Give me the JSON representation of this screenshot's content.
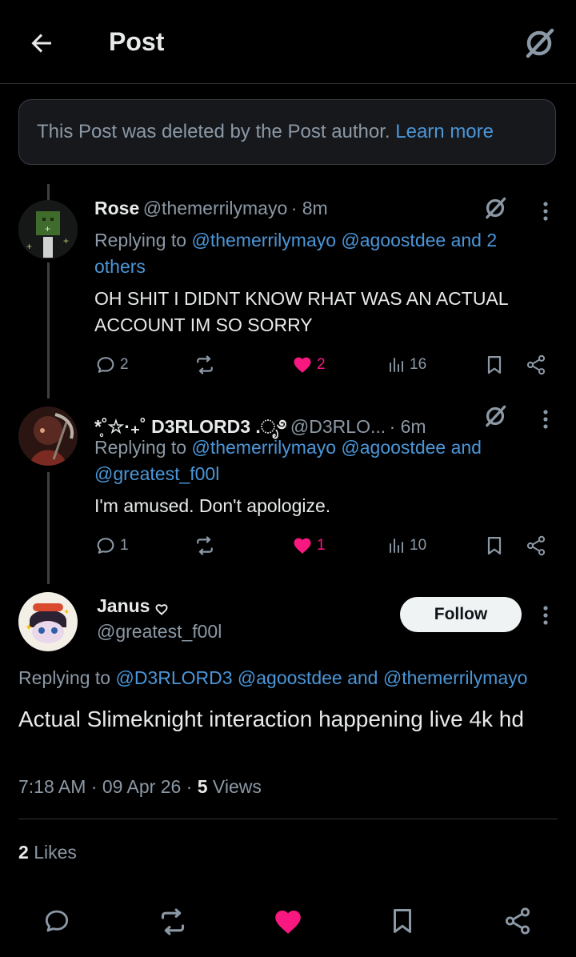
{
  "header": {
    "title": "Post",
    "back_icon": "arrow-left-icon",
    "grok_icon": "grok-icon"
  },
  "deleted_notice": {
    "text": "This Post was deleted by the Post author.",
    "link": "Learn more"
  },
  "replies": [
    {
      "name": "Rose",
      "handle": "@themerrilymayo",
      "time": "· 8m",
      "replying_prefix": "Replying to",
      "replying_line1": "@themerrilymayo @agoostdee and 2",
      "replying_line2": "others",
      "text_line1": "OH SHIT I DIDNT KNOW RHAT WAS AN ACTUAL",
      "text_line2": "ACCOUNT IM SO SORRY",
      "replies_count": "2",
      "reposts_count": "",
      "likes_count": "2",
      "views_count": "16"
    },
    {
      "name": "*̥˚☆·₊˚ D3RLORD3 .ೃ࿔",
      "handle": "@D3RLO...",
      "time": "· 6m",
      "replying_prefix": "Replying to",
      "replying_line1": "@themerrilymayo @agoostdee and",
      "replying_line2": "@greatest_f00l",
      "text_line1": "I'm amused. Don't apologize.",
      "text_line2": "",
      "replies_count": "1",
      "reposts_count": "",
      "likes_count": "1",
      "views_count": "10"
    }
  ],
  "main_post": {
    "name": "Janus",
    "handle": "@greatest_f00l",
    "follow_label": "Follow",
    "replying_prefix": "Replying to",
    "replying_to": "@D3RLORD3 @agoostdee and @themerrilymayo",
    "text": "Actual Slimeknight interaction happening live 4k hd",
    "time": "7:18 AM · 09 Apr 26 ·",
    "views_count": "5",
    "views_label": "Views",
    "likes_count": "2",
    "likes_label": "Likes"
  },
  "colors": {
    "like": "#f91880",
    "link": "#4a96d8",
    "muted": "#8b98a5",
    "background": "#000000"
  }
}
